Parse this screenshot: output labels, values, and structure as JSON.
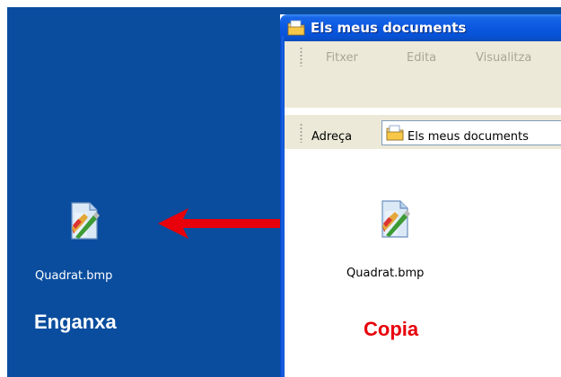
{
  "window": {
    "title": "Els meus documents"
  },
  "menubar": {
    "items": [
      "Fitxer",
      "Edita",
      "Visualitza"
    ]
  },
  "addressbar": {
    "label": "Adreça",
    "value": "Els meus documents"
  },
  "desktop": {
    "file_label": "Quadrat.bmp",
    "action_label": "Enganxa",
    "action_color": "#ffffff"
  },
  "folder": {
    "file_label": "Quadrat.bmp",
    "action_label": "Copia",
    "action_color": "#e8000a"
  },
  "colors": {
    "desktop_bg": "#0a4d9e",
    "titlebar": "#0a58e0",
    "toolbar_bg": "#ece9d8",
    "arrow": "#e8000a"
  },
  "icons": {
    "file": "bitmap-file-icon",
    "folder": "my-documents-folder-icon",
    "arrow": "double-headed-arrow-icon"
  }
}
